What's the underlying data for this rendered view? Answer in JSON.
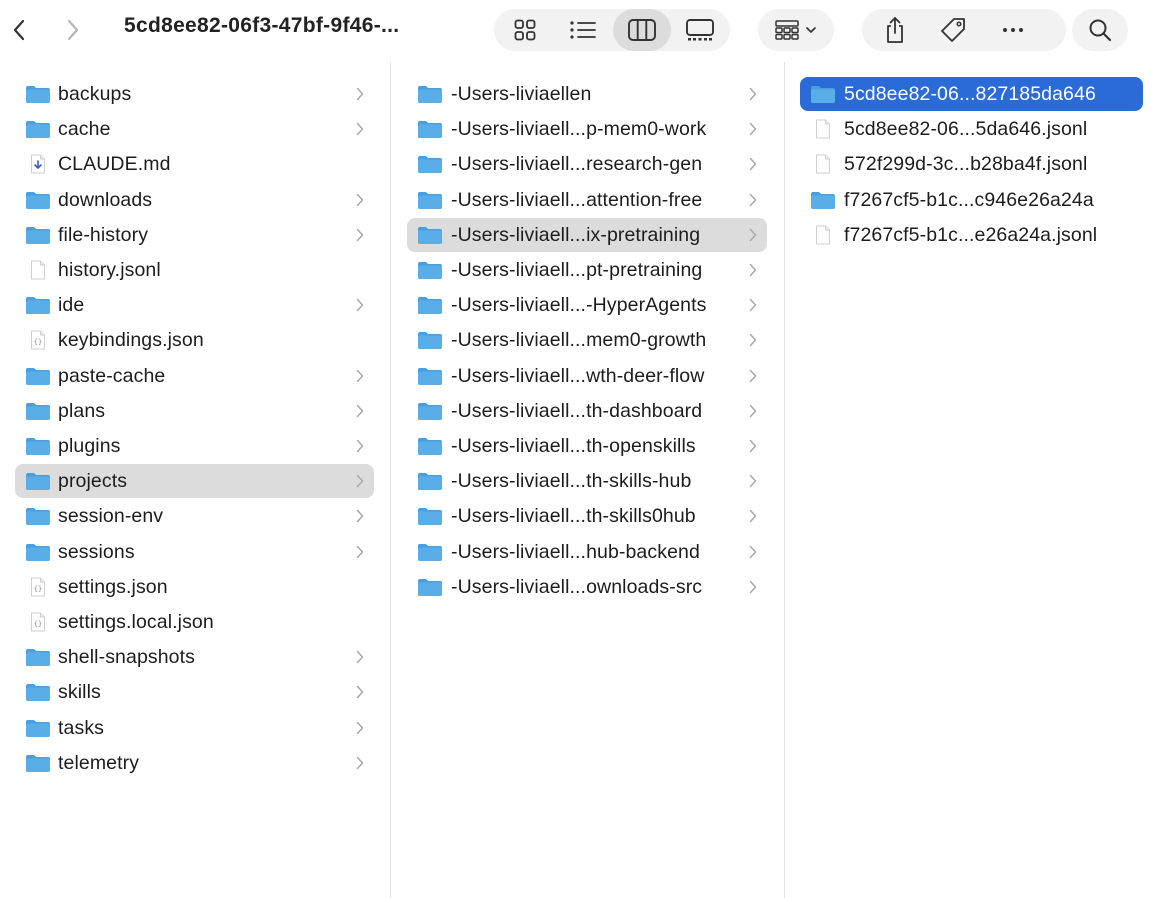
{
  "toolbar": {
    "title": "5cd8ee82-06f3-47bf-9f46-...",
    "icons": {
      "back": "chevron-left-icon",
      "forward": "chevron-right-icon",
      "icon_view": "grid-icon",
      "list_view": "list-icon",
      "column_view": "columns-icon",
      "gallery_view": "gallery-icon",
      "group": "group-icon",
      "share": "share-icon",
      "tag": "tag-icon",
      "more": "ellipsis-icon",
      "search": "search-icon"
    },
    "active_view": "column"
  },
  "colors": {
    "folder": "#5aaee8",
    "folder_tab": "#4a9ee0",
    "selection_blue": "#2a6bd8",
    "selection_gray": "#dcdcdc"
  },
  "columns": [
    {
      "items": [
        {
          "name": "backups",
          "type": "folder",
          "chevron": true
        },
        {
          "name": "cache",
          "type": "folder",
          "chevron": true
        },
        {
          "name": "CLAUDE.md",
          "type": "markdown",
          "chevron": false
        },
        {
          "name": "downloads",
          "type": "folder",
          "chevron": true
        },
        {
          "name": "file-history",
          "type": "folder",
          "chevron": true
        },
        {
          "name": "history.jsonl",
          "type": "file",
          "chevron": false
        },
        {
          "name": "ide",
          "type": "folder",
          "chevron": true
        },
        {
          "name": "keybindings.json",
          "type": "json",
          "chevron": false
        },
        {
          "name": "paste-cache",
          "type": "folder",
          "chevron": true
        },
        {
          "name": "plans",
          "type": "folder",
          "chevron": true
        },
        {
          "name": "plugins",
          "type": "folder",
          "chevron": true
        },
        {
          "name": "projects",
          "type": "folder",
          "chevron": true,
          "selected": "gray"
        },
        {
          "name": "session-env",
          "type": "folder",
          "chevron": true
        },
        {
          "name": "sessions",
          "type": "folder",
          "chevron": true
        },
        {
          "name": "settings.json",
          "type": "json",
          "chevron": false
        },
        {
          "name": "settings.local.json",
          "type": "json",
          "chevron": false
        },
        {
          "name": "shell-snapshots",
          "type": "folder",
          "chevron": true
        },
        {
          "name": "skills",
          "type": "folder",
          "chevron": true
        },
        {
          "name": "tasks",
          "type": "folder",
          "chevron": true
        },
        {
          "name": "telemetry",
          "type": "folder",
          "chevron": true
        }
      ]
    },
    {
      "items": [
        {
          "name": "-Users-liviaellen",
          "type": "folder",
          "chevron": true
        },
        {
          "name": "-Users-liviaell...p-mem0-work",
          "type": "folder",
          "chevron": true
        },
        {
          "name": "-Users-liviaell...research-gen",
          "type": "folder",
          "chevron": true
        },
        {
          "name": "-Users-liviaell...attention-free",
          "type": "folder",
          "chevron": true
        },
        {
          "name": "-Users-liviaell...ix-pretraining",
          "type": "folder",
          "chevron": true,
          "selected": "gray"
        },
        {
          "name": "-Users-liviaell...pt-pretraining",
          "type": "folder",
          "chevron": true
        },
        {
          "name": "-Users-liviaell...-HyperAgents",
          "type": "folder",
          "chevron": true
        },
        {
          "name": "-Users-liviaell...mem0-growth",
          "type": "folder",
          "chevron": true
        },
        {
          "name": "-Users-liviaell...wth-deer-flow",
          "type": "folder",
          "chevron": true
        },
        {
          "name": "-Users-liviaell...th-dashboard",
          "type": "folder",
          "chevron": true
        },
        {
          "name": "-Users-liviaell...th-openskills",
          "type": "folder",
          "chevron": true
        },
        {
          "name": "-Users-liviaell...th-skills-hub",
          "type": "folder",
          "chevron": true
        },
        {
          "name": "-Users-liviaell...th-skills0hub",
          "type": "folder",
          "chevron": true
        },
        {
          "name": "-Users-liviaell...hub-backend",
          "type": "folder",
          "chevron": true
        },
        {
          "name": "-Users-liviaell...ownloads-src",
          "type": "folder",
          "chevron": true
        }
      ]
    },
    {
      "items": [
        {
          "name": "5cd8ee82-06...827185da646",
          "type": "folder",
          "chevron": false,
          "selected": "blue"
        },
        {
          "name": "5cd8ee82-06...5da646.jsonl",
          "type": "file",
          "chevron": false
        },
        {
          "name": "572f299d-3c...b28ba4f.jsonl",
          "type": "file",
          "chevron": false
        },
        {
          "name": "f7267cf5-b1c...c946e26a24a",
          "type": "folder",
          "chevron": false
        },
        {
          "name": "f7267cf5-b1c...e26a24a.jsonl",
          "type": "file",
          "chevron": false
        }
      ]
    }
  ]
}
